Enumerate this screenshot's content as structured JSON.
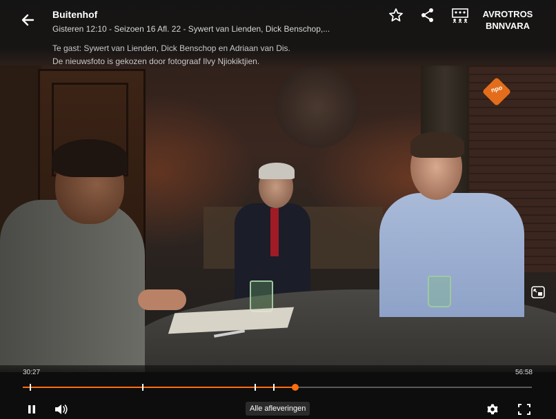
{
  "header": {
    "title": "Buitenhof",
    "subtitle": "Gisteren 12:10 - Seizoen 16 Afl. 22 - Sywert van Lienden, Dick Benschop,...",
    "description": "Te gast: Sywert van Lienden, Dick Benschop en Adriaan van Dis. De nieuwsfoto is gekozen door fotograaf Ilvy Njiokiktjien.",
    "broadcaster_line1": "AVROTROS",
    "broadcaster_line2": "BNNVARA",
    "icons": [
      "back-arrow-icon",
      "star-icon",
      "share-icon",
      "sign-language-icon"
    ]
  },
  "video": {
    "channel_logo": "npo",
    "accent_color": "#ff6d0c"
  },
  "player": {
    "current_time": "30:27",
    "total_time": "56:58",
    "progress": 0.535,
    "chapter_markers": [
      0.013,
      0.235,
      0.455,
      0.492
    ],
    "episodes_label": "Alle afleveringen",
    "state": "playing",
    "icons": [
      "pause-icon",
      "volume-icon",
      "settings-icon",
      "fullscreen-icon",
      "picture-in-picture-icon"
    ]
  }
}
